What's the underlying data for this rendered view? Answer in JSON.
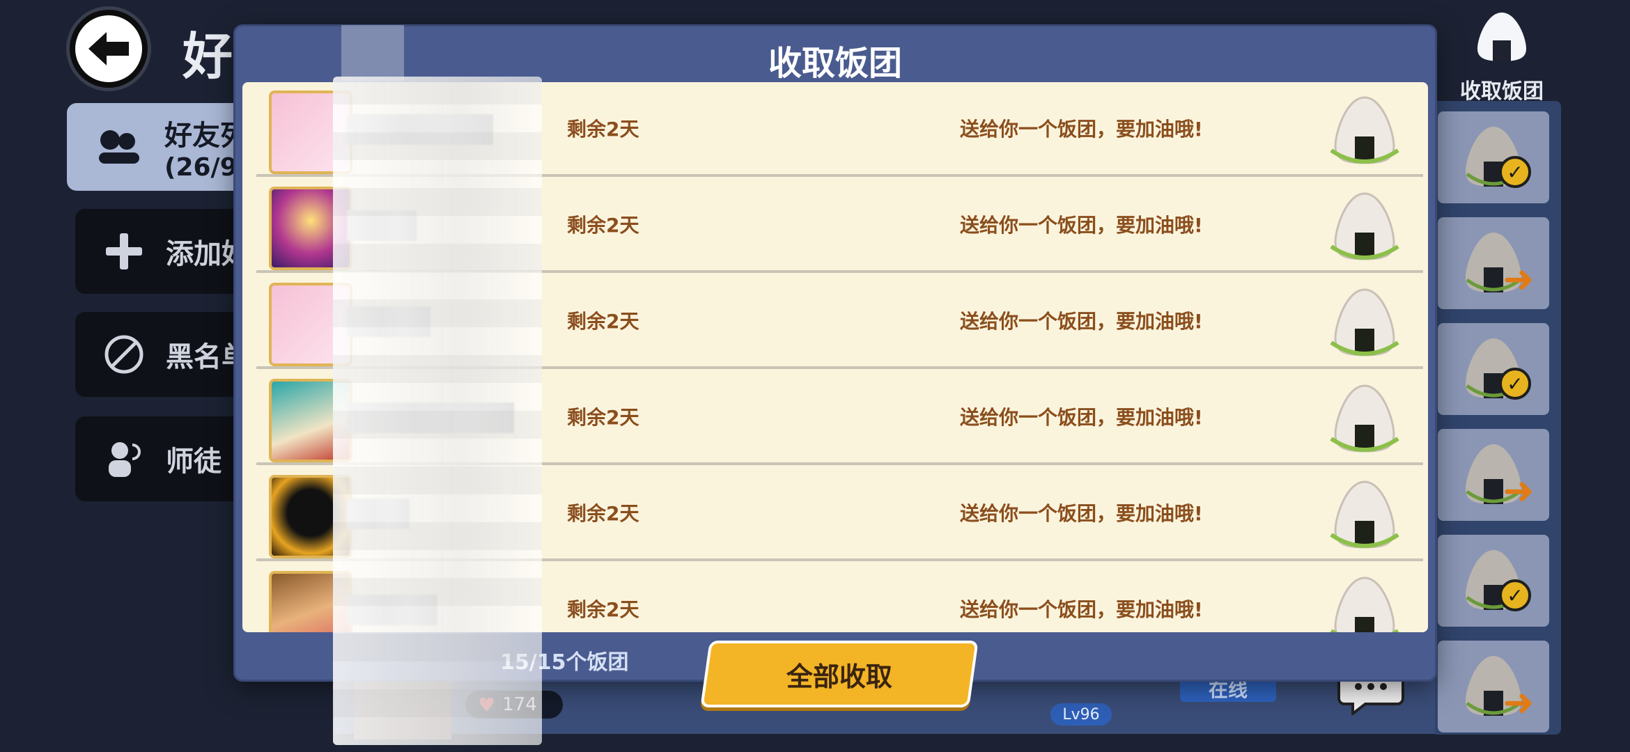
{
  "background": {
    "title": "好友",
    "sidebar": [
      {
        "label": "好友列表",
        "sub": "(26/9",
        "icon": "friends-icon"
      },
      {
        "label": "添加好友",
        "icon": "plus-icon"
      },
      {
        "label": "黑名单",
        "icon": "block-icon"
      },
      {
        "label": "师徒",
        "icon": "mentor-icon"
      }
    ],
    "collect_tab_label": "收取饭团",
    "bottom_row": {
      "likes": "174",
      "level": "Lv96",
      "status": "在线"
    }
  },
  "modal": {
    "title": "收取饭团",
    "rows": [
      {
        "remaining": "剩余2天",
        "message": "送给你一个饭团，要加油哦!"
      },
      {
        "remaining": "剩余2天",
        "message": "送给你一个饭团，要加油哦!"
      },
      {
        "remaining": "剩余2天",
        "message": "送给你一个饭团，要加油哦!"
      },
      {
        "remaining": "剩余2天",
        "message": "送给你一个饭团，要加油哦!"
      },
      {
        "remaining": "剩余2天",
        "message": "送给你一个饭团，要加油哦!"
      },
      {
        "remaining": "剩余2天",
        "message": "送给你一个饭团，要加油哦!"
      }
    ],
    "count_text": "15/15个饭团",
    "collect_all_label": "全部收取"
  },
  "colors": {
    "modal_bg": "#4a5b8f",
    "list_bg": "#fbf4dd",
    "text_brown": "#8a4e1d",
    "button_yellow": "#f3b426"
  }
}
